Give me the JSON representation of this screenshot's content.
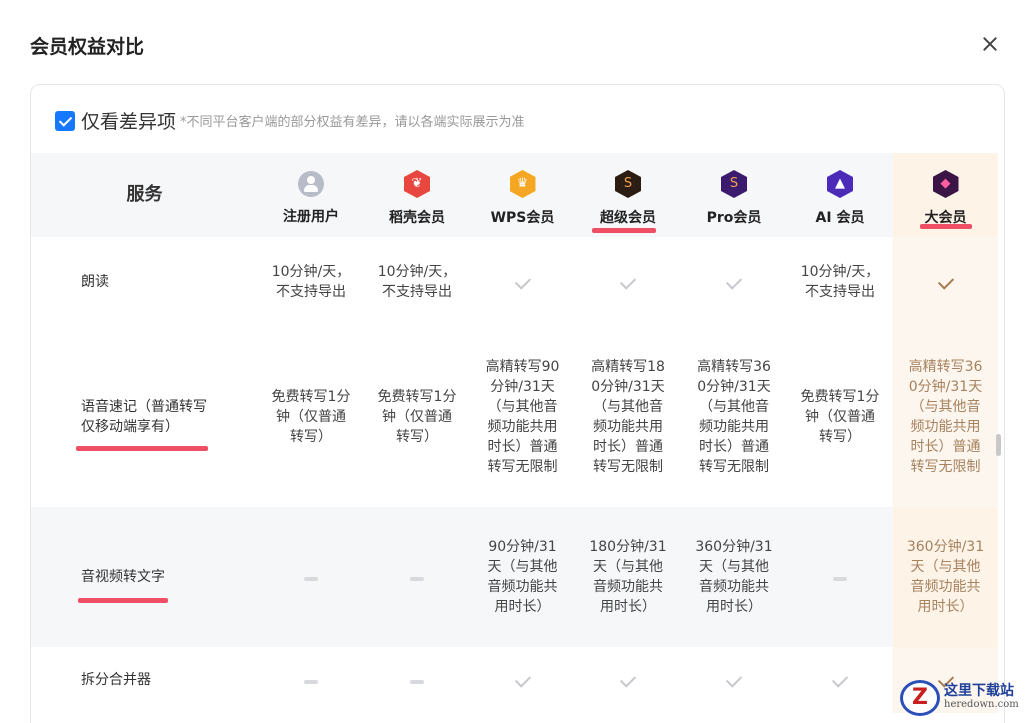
{
  "dialog": {
    "title": "会员权益对比"
  },
  "filter": {
    "label": "仅看差异项",
    "note": "*不同平台客户端的部分权益有差异，请以各端实际展示为准",
    "checked": true
  },
  "columns": {
    "service": "服务",
    "registered": "注册用户",
    "daoke": "稻壳会员",
    "wps": "WPS会员",
    "super": "超级会员",
    "pro": "Pro会员",
    "ai": "AI 会员",
    "big": "大会员"
  },
  "rows": [
    {
      "name": "朗读",
      "registered": "10分钟/天，不支持导出",
      "daoke": "10分钟/天，不支持导出",
      "wps": "check",
      "super": "check",
      "pro": "check",
      "ai": "10分钟/天，不支持导出",
      "big": "check"
    },
    {
      "name": "语音速记（普通转写仅移动端享有）",
      "registered": "免费转写1分钟（仅普通转写）",
      "daoke": "免费转写1分钟（仅普通转写）",
      "wps": "高精转写90分钟/31天（与其他音频功能共用时长）普通转写无限制",
      "super": "高精转写180分钟/31天（与其他音频功能共用时长）普通转写无限制",
      "pro": "高精转写360分钟/31天（与其他音频功能共用时长）普通转写无限制",
      "ai": "免费转写1分钟（仅普通转写）",
      "big": "高精转写360分钟/31天（与其他音频功能共用时长）普通转写无限制"
    },
    {
      "name": "音视频转文字",
      "registered": "dash",
      "daoke": "dash",
      "wps": "90分钟/31天（与其他音频功能共用时长）",
      "super": "180分钟/31天（与其他音频功能共用时长）",
      "pro": "360分钟/31天（与其他音频功能共用时长）",
      "ai": "dash",
      "big": "360分钟/31天（与其他音频功能共用时长）"
    },
    {
      "name": "拆分合并器",
      "registered": "dash",
      "daoke": "dash",
      "wps": "check",
      "super": "check",
      "pro": "check",
      "ai": "check",
      "big": "check"
    }
  ],
  "icons": {
    "registered": "user-icon",
    "daoke": "daoke-icon",
    "wps": "crown-icon",
    "super": "super-member-icon",
    "pro": "pro-member-icon",
    "ai": "ai-member-icon",
    "big": "big-member-icon"
  },
  "colors": {
    "accent_blue": "#1677ff",
    "highlight_red": "#ef4f64",
    "big_member_bg": "#fdf3e7",
    "big_member_text": "#a6825f",
    "daoke": "#e8473f",
    "wps": "#f5a623",
    "super": "#2b1d14",
    "pro": "#3b1b6e",
    "ai": "#4b2bb8",
    "big": "#3a1545"
  },
  "watermark": {
    "logo": "Z",
    "cn": "这里下载站",
    "en": "heredown.com"
  }
}
